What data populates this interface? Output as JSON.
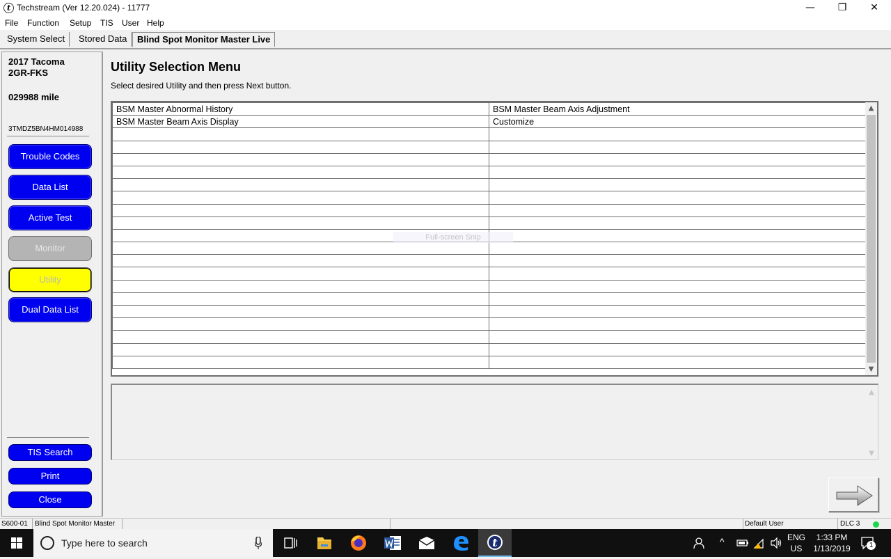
{
  "window": {
    "title": "Techstream (Ver 12.20.024) - 11777",
    "app_icon_glyph": "t",
    "controls": {
      "minimize": "—",
      "maximize": "❐",
      "close": "✕"
    }
  },
  "menu": [
    "File",
    "Function",
    "Setup",
    "TIS",
    "User",
    "Help"
  ],
  "tabs": [
    {
      "label": "System Select",
      "active": false
    },
    {
      "label": "Stored Data",
      "active": false
    },
    {
      "label": "Blind Spot Monitor Master Live",
      "active": true
    }
  ],
  "vehicle": {
    "model": "2017 Tacoma",
    "engine": "2GR-FKS",
    "mileage": "029988 mile",
    "vin": "3TMDZ5BN4HM014988"
  },
  "nav_buttons": [
    {
      "label": "Trouble Codes",
      "state": "enabled"
    },
    {
      "label": "Data List",
      "state": "enabled"
    },
    {
      "label": "Active Test",
      "state": "enabled"
    },
    {
      "label": "Monitor",
      "state": "disabled"
    },
    {
      "label": "Utility",
      "state": "selected"
    },
    {
      "label": "Dual Data List",
      "state": "enabled"
    }
  ],
  "bottom_buttons": {
    "tis_search": "TIS Search",
    "print": "Print",
    "close": "Close"
  },
  "main": {
    "heading": "Utility Selection Menu",
    "instruction": "Select desired Utility and then press Next button.",
    "utility_rows": [
      [
        "BSM Master Abnormal History",
        "BSM Master Beam Axis Adjustment"
      ],
      [
        "BSM Master Beam Axis Display",
        "Customize"
      ]
    ],
    "empty_row_count": 19,
    "overlay_text": "Full-screen Snip"
  },
  "statusbar": {
    "code": "S600-01",
    "system": "Blind Spot Monitor Master",
    "user": "Default User",
    "connection": "DLC 3",
    "connection_color": "#19d64a"
  },
  "taskbar": {
    "search_placeholder": "Type here to search",
    "language": "ENG",
    "region": "US",
    "time": "1:33 PM",
    "date": "1/13/2019",
    "notification_count": "1"
  },
  "colors": {
    "nav_button": "#0000f0",
    "nav_selected": "#ffff00",
    "nav_disabled": "#b4b4b4"
  }
}
